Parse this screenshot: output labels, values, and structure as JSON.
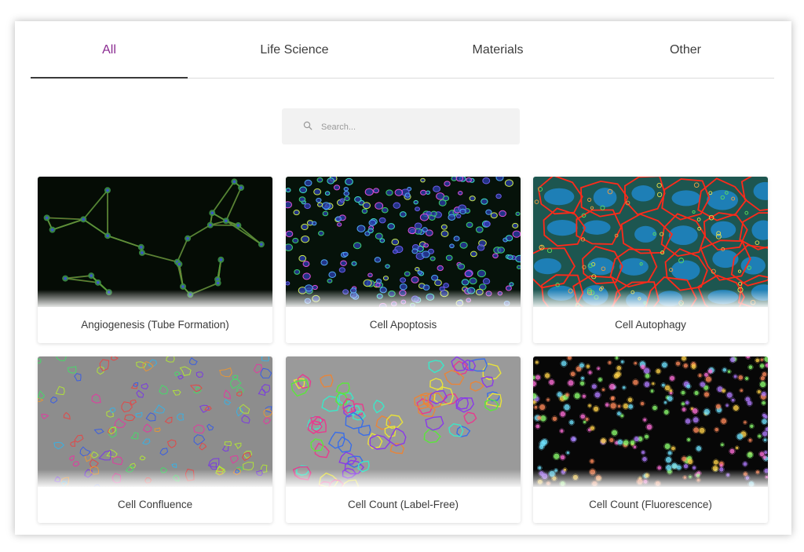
{
  "tabs": [
    {
      "label": "All",
      "active": true
    },
    {
      "label": "Life Science",
      "active": false
    },
    {
      "label": "Materials",
      "active": false
    },
    {
      "label": "Other",
      "active": false
    }
  ],
  "search": {
    "placeholder": "Search..."
  },
  "colors": {
    "accent": "#8a2b91",
    "tab_text": "#3d3d3d",
    "search_bg": "#f2f2f2"
  },
  "cards": [
    {
      "title": "Angiogenesis (Tube Formation)",
      "image": "angiogenesis-fluorescence-image"
    },
    {
      "title": "Cell Apoptosis",
      "image": "apoptosis-fluorescence-image"
    },
    {
      "title": "Cell Autophagy",
      "image": "autophagy-segmentation-image"
    },
    {
      "title": "Cell Confluence",
      "image": "confluence-brightfield-image"
    },
    {
      "title": "Cell Count (Label-Free)",
      "image": "label-free-count-image"
    },
    {
      "title": "Cell Count (Fluorescence)",
      "image": "fluorescence-count-image"
    }
  ]
}
